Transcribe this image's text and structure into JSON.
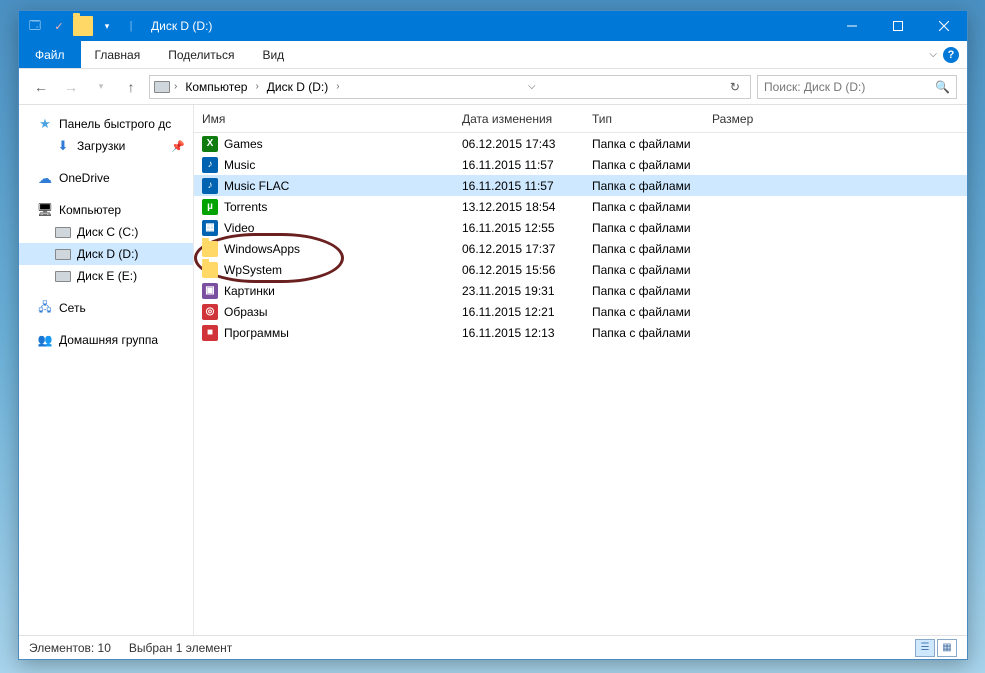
{
  "window": {
    "title": "Диск D (D:)"
  },
  "ribbon": {
    "file": "Файл",
    "tabs": [
      "Главная",
      "Поделиться",
      "Вид"
    ]
  },
  "breadcrumb": {
    "root": "Компьютер",
    "current": "Диск D (D:)"
  },
  "search": {
    "placeholder": "Поиск: Диск D (D:)"
  },
  "nav": {
    "quick": "Панель быстрого дс",
    "downloads": "Загрузки",
    "onedrive": "OneDrive",
    "computer": "Компьютер",
    "drives": [
      {
        "label": "Диск C (C:)"
      },
      {
        "label": "Диск D (D:)"
      },
      {
        "label": "Диск E (E:)"
      }
    ],
    "network": "Сеть",
    "homegroup": "Домашняя группа"
  },
  "columns": {
    "name": "Имя",
    "date": "Дата изменения",
    "type": "Тип",
    "size": "Размер"
  },
  "rows": [
    {
      "name": "Games",
      "date": "06.12.2015 17:43",
      "type": "Папка с файлами",
      "icon": "games",
      "color": "#107c10"
    },
    {
      "name": "Music",
      "date": "16.11.2015 11:57",
      "type": "Папка с файлами",
      "icon": "music",
      "color": "#0063b1"
    },
    {
      "name": "Music FLAC",
      "date": "16.11.2015 11:57",
      "type": "Папка с файлами",
      "icon": "music",
      "color": "#0063b1",
      "selected": true
    },
    {
      "name": "Torrents",
      "date": "13.12.2015 18:54",
      "type": "Папка с файлами",
      "icon": "torrent",
      "color": "#00a300"
    },
    {
      "name": "Video",
      "date": "16.11.2015 12:55",
      "type": "Папка с файлами",
      "icon": "video",
      "color": "#0063b1"
    },
    {
      "name": "WindowsApps",
      "date": "06.12.2015 17:37",
      "type": "Папка с файлами",
      "icon": "folder"
    },
    {
      "name": "WpSystem",
      "date": "06.12.2015 15:56",
      "type": "Папка с файлами",
      "icon": "folder"
    },
    {
      "name": "Картинки",
      "date": "23.11.2015 19:31",
      "type": "Папка с файлами",
      "icon": "picture",
      "color": "#7b4fa0"
    },
    {
      "name": "Образы",
      "date": "16.11.2015 12:21",
      "type": "Папка с файлами",
      "icon": "iso",
      "color": "#d13438"
    },
    {
      "name": "Программы",
      "date": "16.11.2015 12:13",
      "type": "Папка с файлами",
      "icon": "apps",
      "color": "#d13438"
    }
  ],
  "status": {
    "count": "Элементов: 10",
    "selection": "Выбран 1 элемент"
  },
  "icon_glyphs": {
    "games": "X",
    "music": "♪",
    "torrent": "µ",
    "video": "▦",
    "picture": "▣",
    "iso": "◎",
    "apps": "■"
  }
}
